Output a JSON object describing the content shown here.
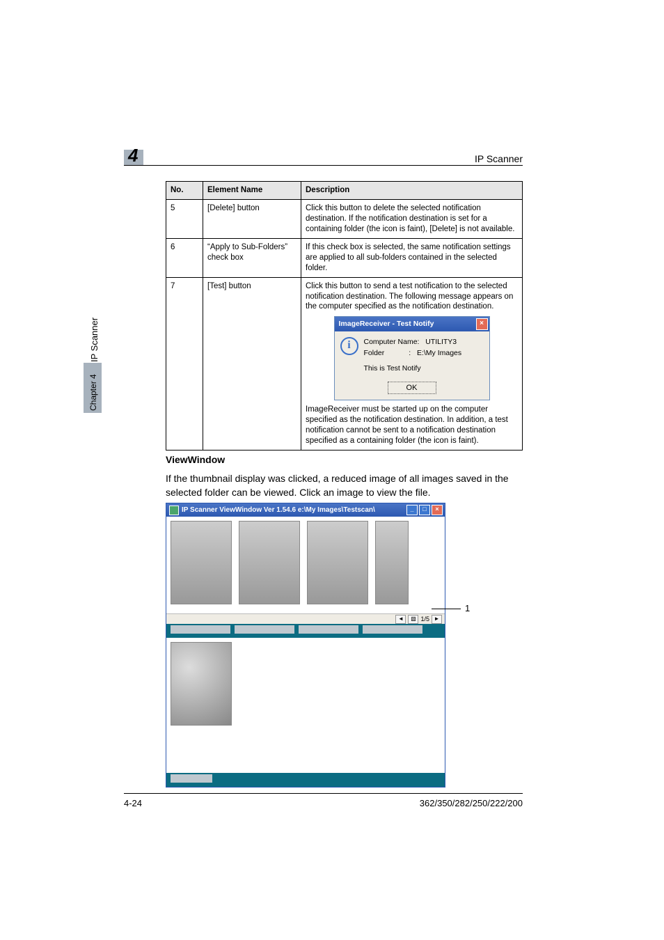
{
  "header": {
    "chapter_number": "4",
    "right_label": "IP Scanner"
  },
  "table": {
    "head": {
      "no": "No.",
      "name": "Element Name",
      "desc": "Description"
    },
    "rows": [
      {
        "no": "5",
        "name": "[Delete] button",
        "desc": "Click this button to delete the selected notification destination. If the notification destination is set for a containing folder (the icon is faint), [Delete] is not available."
      },
      {
        "no": "6",
        "name": "“Apply to Sub-Folders” check box",
        "desc": "If this check box is selected, the same notification settings are applied to all sub-folders contained in the selected folder."
      },
      {
        "no": "7",
        "name": "[Test] button",
        "desc_pre": "Click this button to send a test notification to the selected notification destination. The following message appears on the computer specified as the notification destination.",
        "desc_post": "ImageReceiver must be started up on the computer specified as the notification destination. In addition, a test notification cannot be sent to a notification destination specified as a containing folder (the icon is faint)."
      }
    ]
  },
  "dialog": {
    "title": "ImageReceiver - Test Notify",
    "line1a": "Computer Name:",
    "line1b": "UTILITY3",
    "line2a": "Folder            :",
    "line2b": "E:\\My Images",
    "line3": "This is Test Notify",
    "ok": "OK"
  },
  "section": {
    "heading": "ViewWindow",
    "body": "If the thumbnail display was clicked, a reduced image of all images saved in the selected folder can be viewed. Click an image to view the file."
  },
  "viewwin": {
    "title": "IP Scanner ViewWindow Ver 1.54.6 e:\\My Images\\Testscan\\",
    "page_indicator": "1/5"
  },
  "callout": {
    "one": "1"
  },
  "side": {
    "scanner": "IP Scanner",
    "chapter": "Chapter 4"
  },
  "footer": {
    "left": "4-24",
    "right": "362/350/282/250/222/200"
  }
}
